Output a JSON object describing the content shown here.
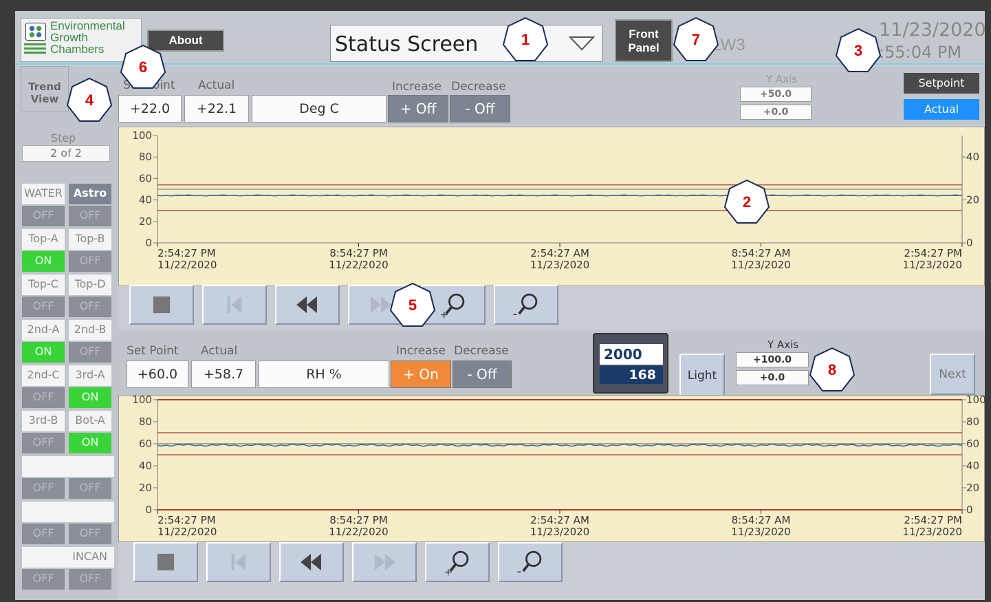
{
  "header": {
    "logo_lines": [
      "Environmental",
      "Growth",
      "Chambers"
    ],
    "about_label": "About",
    "screen_select_value": "Status Screen",
    "front_panel_label": [
      "Front",
      "Panel"
    ],
    "chamber_id": "LW3",
    "date": "11/23/2020",
    "time": ":55:04 PM"
  },
  "left_panel": {
    "trend_view_label": [
      "Trend",
      "View"
    ],
    "step_label": "Step",
    "step_value": "2  of  2",
    "outputs": [
      {
        "label": "WATER",
        "state": "OFF"
      },
      {
        "label": "Astro SSR",
        "state": "OFF"
      },
      {
        "label": "Top-A",
        "state": "ON"
      },
      {
        "label": "Top-B",
        "state": "OFF"
      },
      {
        "label": "Top-C",
        "state": "OFF"
      },
      {
        "label": "Top-D",
        "state": "OFF"
      },
      {
        "label": "2nd-A",
        "state": "ON"
      },
      {
        "label": "2nd-B",
        "state": "OFF"
      },
      {
        "label": "2nd-C",
        "state": "OFF"
      },
      {
        "label": "3rd-A",
        "state": "ON"
      },
      {
        "label": "3rd-B",
        "state": "OFF"
      },
      {
        "label": "Bot-A",
        "state": "ON"
      },
      {
        "label": "",
        "state": "OFF"
      },
      {
        "label": "",
        "state": "OFF"
      },
      {
        "label": "",
        "state": "OFF"
      },
      {
        "label": "",
        "state": "OFF"
      },
      {
        "label": "INCAN",
        "state": "OFF"
      },
      {
        "label": "",
        "state": "OFF"
      }
    ]
  },
  "temp": {
    "setpoint_label": "Set Point",
    "actual_label": "Actual",
    "setpoint": "+22.0",
    "actual": "+22.1",
    "units": "Deg C",
    "increase_label": "Increase",
    "decrease_label": "Decrease",
    "increase_state": "+ Off",
    "decrease_state": "- Off",
    "yaxis_label": "Y Axis",
    "yaxis_max": "+50.0",
    "yaxis_min": "+0.0",
    "legend_setpoint": "Setpoint",
    "legend_actual": "Actual"
  },
  "humidity": {
    "setpoint_label": "Set Point",
    "actual_label": "Actual",
    "setpoint": "+60.0",
    "actual": "+58.7",
    "units": "RH %",
    "increase_label": "Increase",
    "decrease_label": "Decrease",
    "increase_state": "+ On",
    "decrease_state": "- Off",
    "light_top": "2000",
    "light_bottom": "168",
    "light_label": "Light",
    "yaxis_label": "Y Axis",
    "yaxis_max": "+100.0",
    "yaxis_min": "+0.0",
    "next_label": "Next"
  },
  "x_ticks": [
    [
      "2:54:27 PM",
      "11/22/2020"
    ],
    [
      "8:54:27 PM",
      "11/22/2020"
    ],
    [
      "2:54:27 AM",
      "11/23/2020"
    ],
    [
      "8:54:27 AM",
      "11/23/2020"
    ],
    [
      "2:54:27 PM",
      "11/23/2020"
    ]
  ],
  "callouts": [
    "1",
    "2",
    "3",
    "4",
    "5",
    "6",
    "7",
    "8"
  ],
  "chart_data": [
    {
      "type": "line",
      "left_ticks": [
        "100",
        "80",
        "60",
        "40",
        "20",
        "0"
      ],
      "right_ticks": [
        "40",
        "20",
        "0"
      ],
      "ylim_left": [
        0,
        100
      ],
      "ylim_right": [
        0,
        50
      ],
      "series": [
        {
          "name": "Setpoint",
          "color": "#c0392b",
          "values_right": [
            22.0
          ]
        },
        {
          "name": "Actual",
          "color": "#3a6ea5",
          "values_right": [
            22.1
          ]
        }
      ],
      "limit_lines_right": [
        27,
        25,
        15
      ]
    },
    {
      "type": "line",
      "left_ticks": [
        "100",
        "80",
        "60",
        "40",
        "20",
        "0"
      ],
      "right_ticks": [
        "100",
        "80",
        "60",
        "40",
        "20",
        "0"
      ],
      "ylim_left": [
        0,
        100
      ],
      "ylim_right": [
        0,
        100
      ],
      "series": [
        {
          "name": "Setpoint",
          "color": "#c0392b",
          "values_right": [
            60.0
          ]
        },
        {
          "name": "Actual",
          "color": "#3a6ea5",
          "values_right": [
            58.7
          ]
        }
      ],
      "limit_lines_right": [
        70,
        50
      ]
    }
  ]
}
